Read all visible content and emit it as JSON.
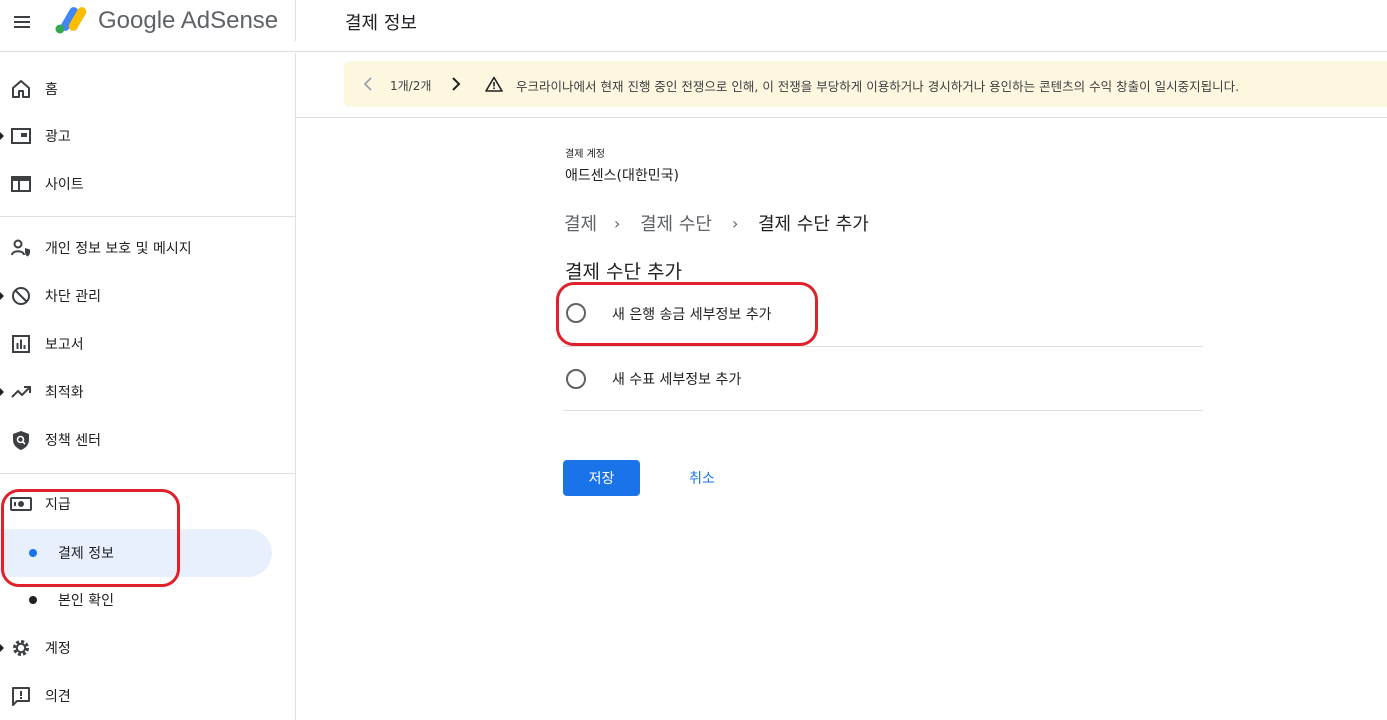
{
  "header": {
    "brand": "Google AdSense",
    "page_title": "결제 정보",
    "menu_icon": "hamburger-menu-icon"
  },
  "sidebar": {
    "items": [
      {
        "label": "홈",
        "icon": "home-icon"
      },
      {
        "label": "광고",
        "icon": "ad-unit-icon"
      },
      {
        "label": "사이트",
        "icon": "web-icon"
      },
      {
        "label": "개인 정보 보호 및 메시지",
        "icon": "person-shield-icon"
      },
      {
        "label": "차단 관리",
        "icon": "block-icon"
      },
      {
        "label": "보고서",
        "icon": "bar-chart-icon"
      },
      {
        "label": "최적화",
        "icon": "trending-up-icon"
      },
      {
        "label": "정책 센터",
        "icon": "policy-shield-icon"
      },
      {
        "label": "지급",
        "icon": "payments-icon"
      },
      {
        "label": "계정",
        "icon": "gear-icon"
      },
      {
        "label": "의견",
        "icon": "feedback-icon"
      }
    ],
    "payments_sub": [
      {
        "label": "결제 정보",
        "active": true
      },
      {
        "label": "본인 확인",
        "active": false
      }
    ]
  },
  "banner": {
    "pager": "1개/2개",
    "message": "우크라이나에서 현재 진행 중인 전쟁으로 인해, 이 전쟁을 부당하게 이용하거나 경시하거나 용인하는 콘텐츠의 수익 창출이 일시중지됩니다.",
    "background": "#fef7e0"
  },
  "main": {
    "account_label": "결제 계정",
    "account_value": "애드센스(대한민국)",
    "breadcrumb": [
      "결제",
      "결제 수단",
      "결제 수단 추가"
    ],
    "breadcrumb_sep": "›",
    "section_title": "결제 수단 추가",
    "options": [
      {
        "label": "새 은행 송금 세부정보 추가",
        "selected": false
      },
      {
        "label": "새 수표 세부정보 추가",
        "selected": false
      }
    ],
    "save_label": "저장",
    "cancel_label": "취소"
  },
  "colors": {
    "accent": "#1a73e8",
    "annotation": "#e0202a"
  }
}
